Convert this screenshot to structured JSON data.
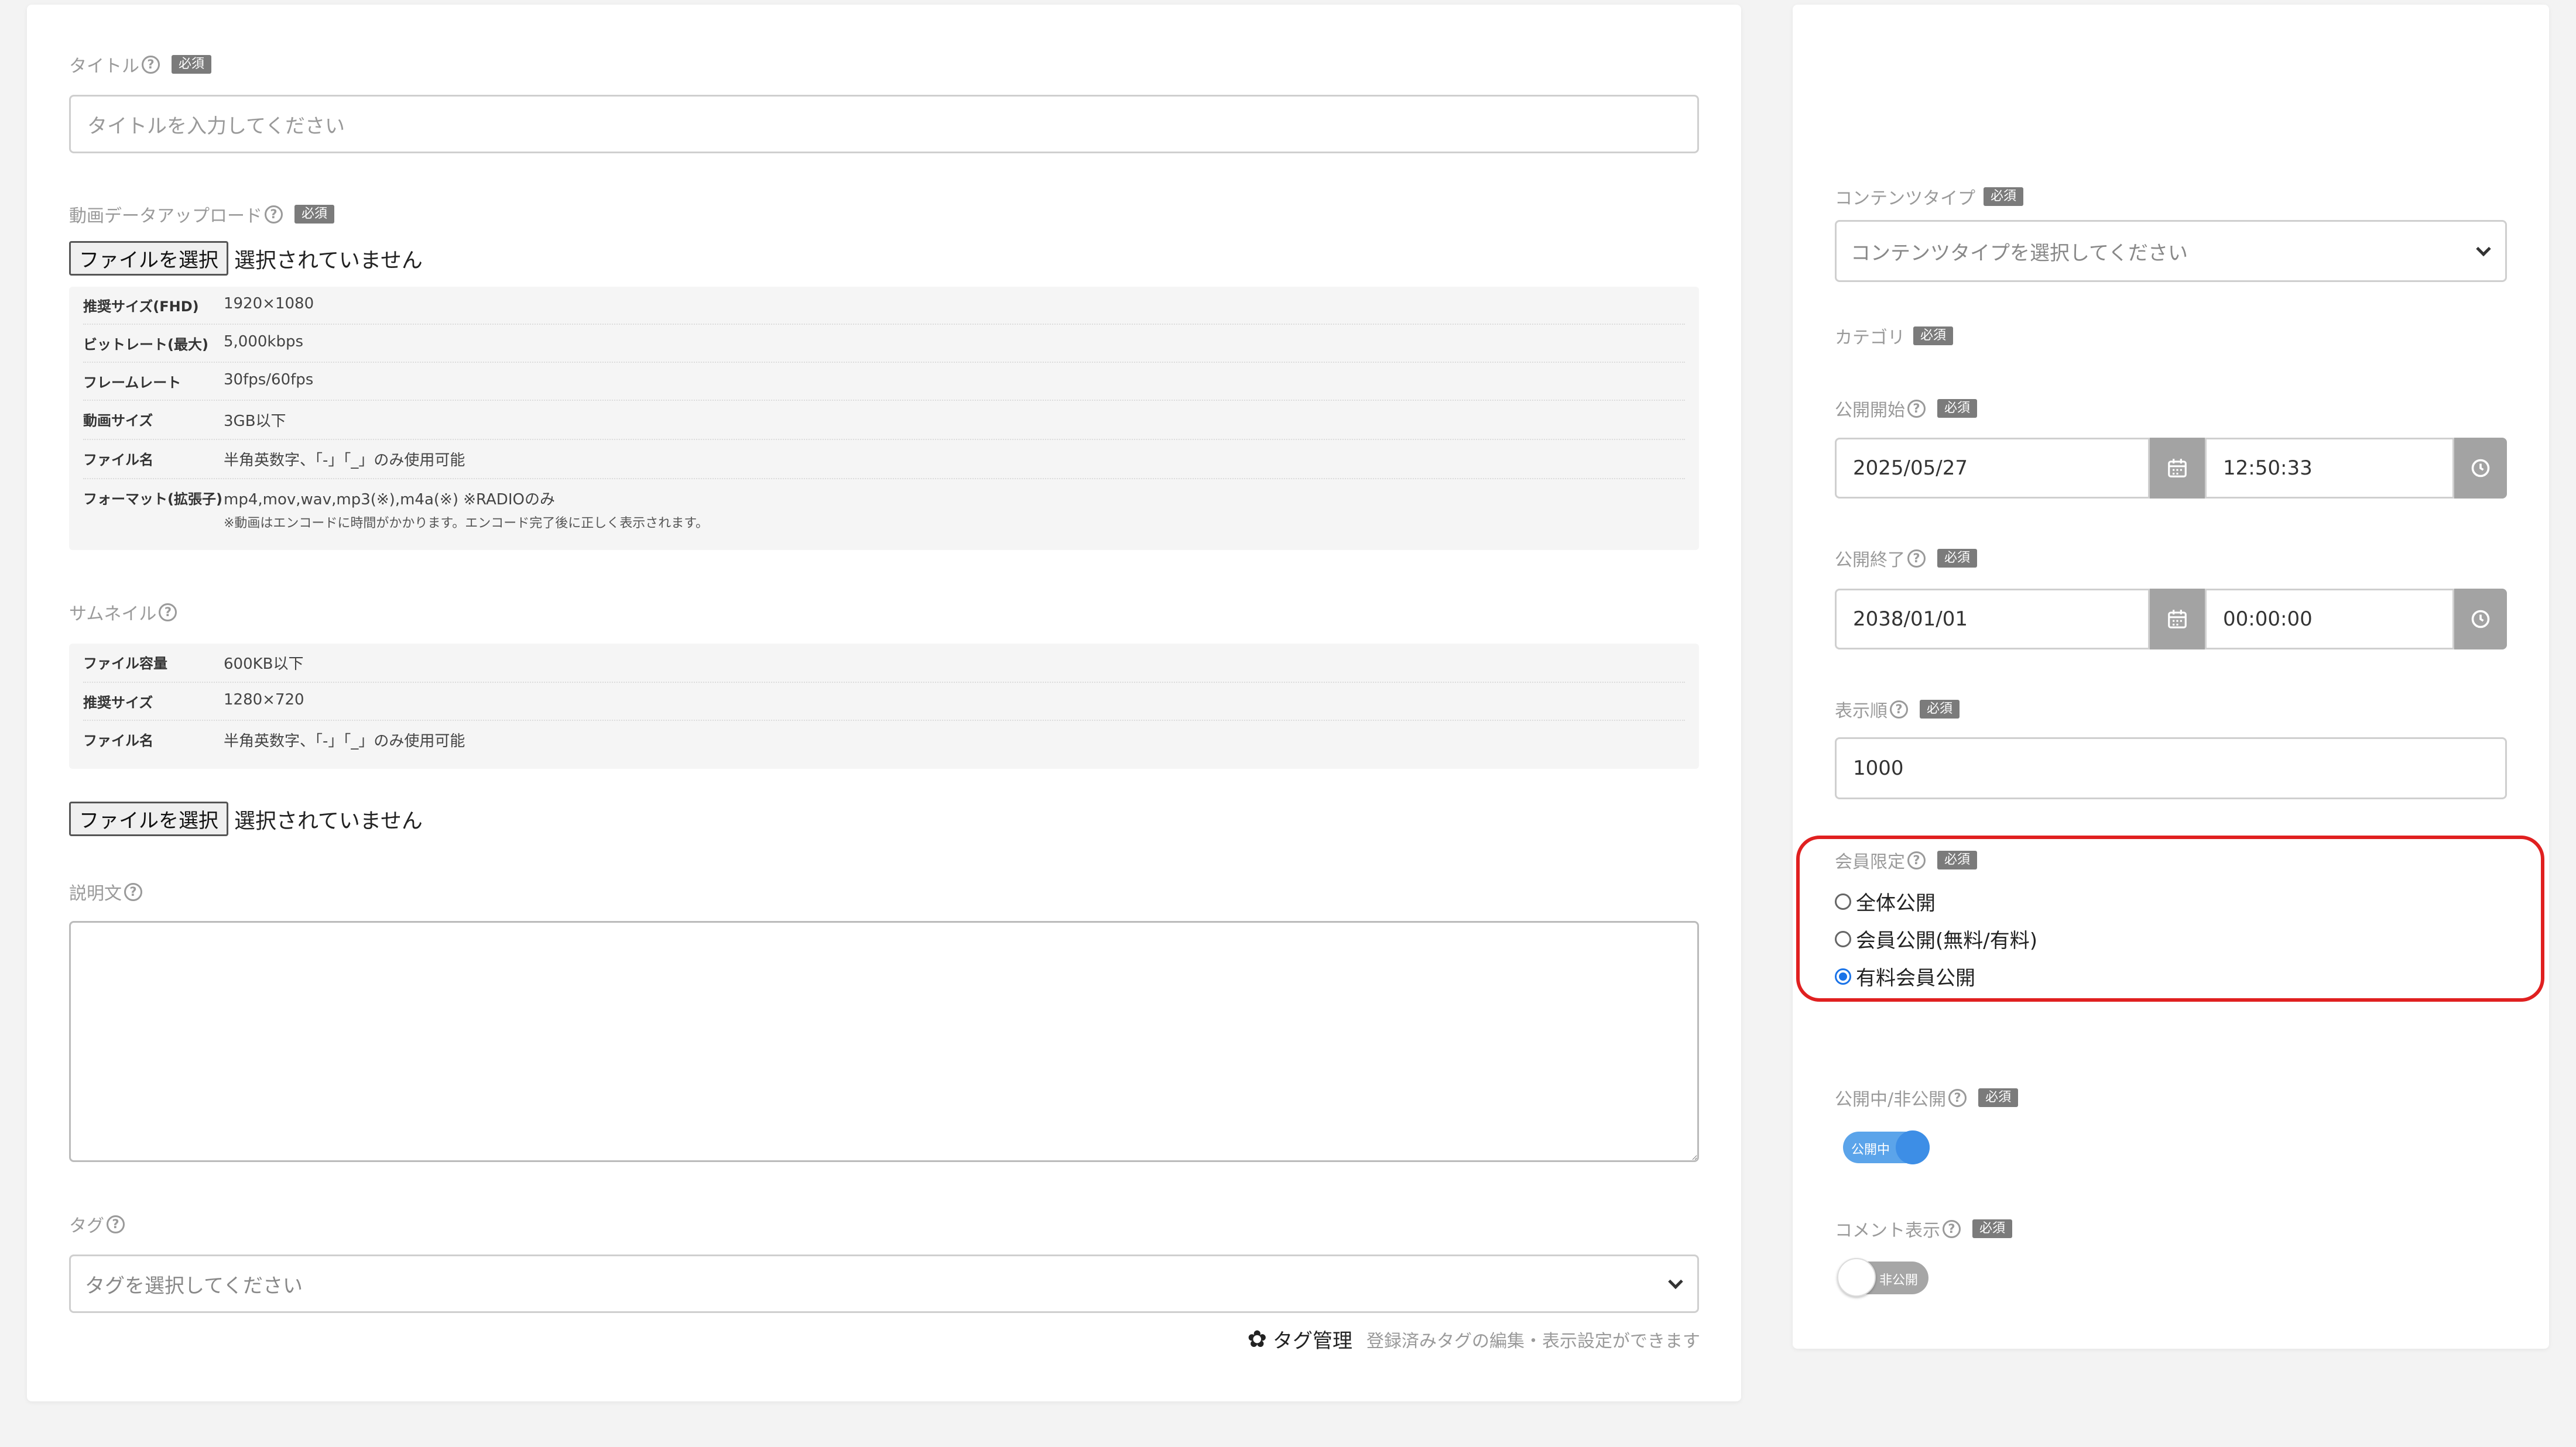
{
  "common": {
    "required": "必須",
    "help": "?"
  },
  "left": {
    "title_label": "タイトル",
    "title_placeholder": "タイトルを入力してください",
    "video_label": "動画データアップロード",
    "file_button": "ファイルを選択",
    "file_none": "選択されていません",
    "video_specs": [
      {
        "key": "推奨サイズ(FHD)",
        "value": "1920×1080"
      },
      {
        "key": "ビットレート(最大)",
        "value": "5,000kbps"
      },
      {
        "key": "フレームレート",
        "value": "30fps/60fps"
      },
      {
        "key": "動画サイズ",
        "value": "3GB以下"
      },
      {
        "key": "ファイル名",
        "value": "半角英数字、「-」「_」のみ使用可能"
      },
      {
        "key": "フォーマット(拡張子)",
        "value": "mp4,mov,wav,mp3(※),m4a(※) ※RADIOのみ",
        "note": "※動画はエンコードに時間がかかります。エンコード完了後に正しく表示されます。"
      }
    ],
    "thumb_label": "サムネイル",
    "thumb_specs": [
      {
        "key": "ファイル容量",
        "value": "600KB以下"
      },
      {
        "key": "推奨サイズ",
        "value": "1280×720"
      },
      {
        "key": "ファイル名",
        "value": "半角英数字、「-」「_」のみ使用可能"
      }
    ],
    "desc_label": "説明文",
    "tag_label": "タグ",
    "tag_placeholder": "タグを選択してください",
    "tag_manage": "タグ管理",
    "tag_manage_hint": "登録済みタグの編集・表示設定ができます"
  },
  "right": {
    "content_type_label": "コンテンツタイプ",
    "content_type_placeholder": "コンテンツタイプを選択してください",
    "category_label": "カテゴリ",
    "publish_start_label": "公開開始",
    "publish_start_date": "2025/05/27",
    "publish_start_time": "12:50:33",
    "publish_end_label": "公開終了",
    "publish_end_date": "2038/01/01",
    "publish_end_time": "00:00:00",
    "order_label": "表示順",
    "order_value": "1000",
    "member_label": "会員限定",
    "member_options": [
      "全体公開",
      "会員公開(無料/有料)",
      "有料会員公開"
    ],
    "member_selected": 2,
    "visibility_label": "公開中/非公開",
    "visibility_on_text": "公開中",
    "comment_label": "コメント表示",
    "comment_off_text": "非公開"
  },
  "colors": {
    "highlight": "#e02020",
    "toggle_on": "#3d8ee6",
    "badge": "#7b7b7b"
  }
}
